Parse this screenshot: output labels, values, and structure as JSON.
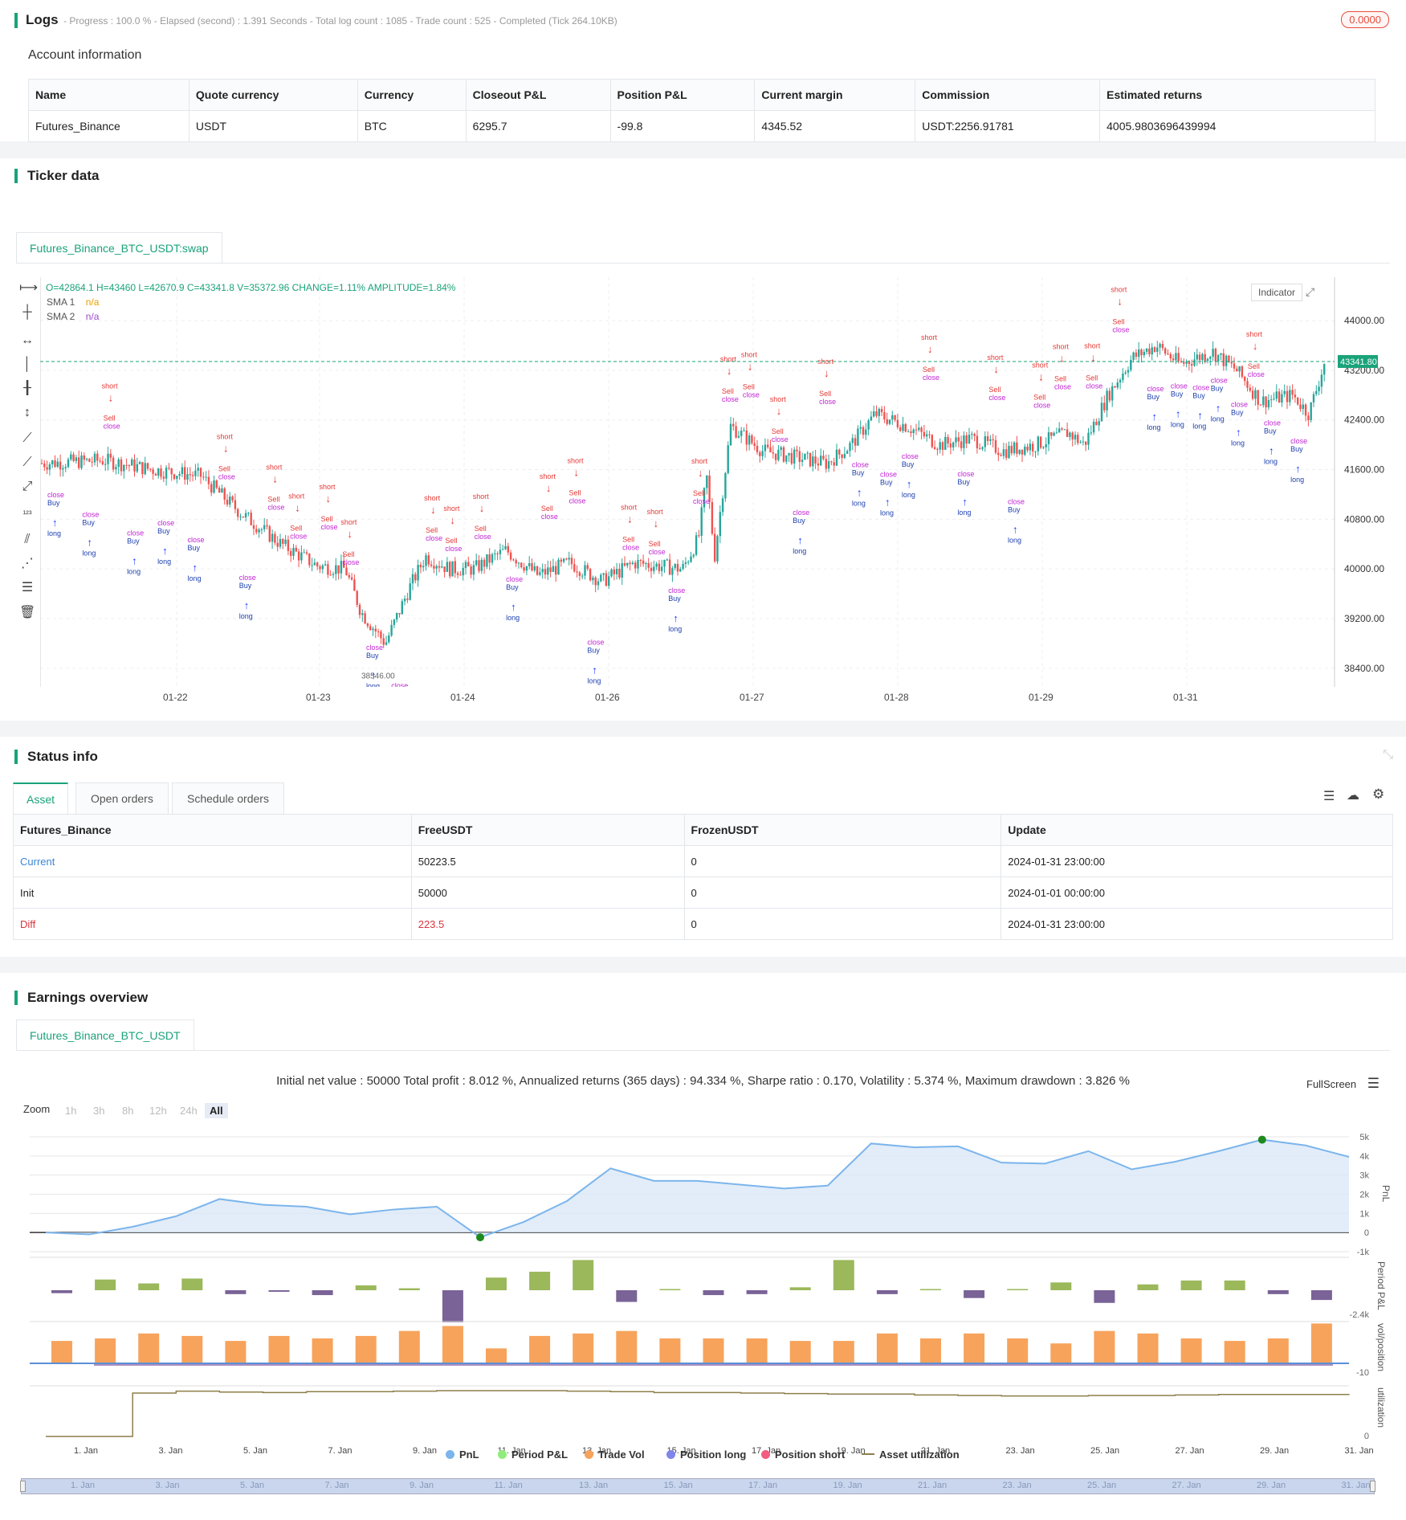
{
  "logs": {
    "title": "Logs",
    "progress_text": "- Progress : 100.0 % - Elapsed (second) : 1.391 Seconds - Total log count : 1085 - Trade count : 525 - Completed (Tick 264.10KB)",
    "badge": "0.0000"
  },
  "account": {
    "title": "Account information",
    "headers": [
      "Name",
      "Quote currency",
      "Currency",
      "Closeout P&L",
      "Position P&L",
      "Current margin",
      "Commission",
      "Estimated returns"
    ],
    "row": [
      "Futures_Binance",
      "USDT",
      "BTC",
      "6295.7",
      "-99.8",
      "4345.52",
      "USDT:2256.91781",
      "4005.9803696439994"
    ]
  },
  "ticker": {
    "title": "Ticker data",
    "tab": "Futures_Binance_BTC_USDT:swap",
    "ohlc": "O=42864.1 H=43460 L=42670.9 C=43341.8 V=35372.96 CHANGE=1.11% AMPLITUDE=1.84%",
    "sma1_label": "SMA 1",
    "sma1_value": "n/a",
    "sma2_label": "SMA 2",
    "sma2_value": "n/a",
    "indicator_btn": "Indicator",
    "last_price": "43341.80",
    "low_marker": "38546.00",
    "y_ticks": [
      "44000.00",
      "43200.00",
      "42400.00",
      "41600.00",
      "40800.00",
      "40000.00",
      "39200.00",
      "38400.00"
    ],
    "x_ticks": [
      "01-22",
      "01-23",
      "01-24",
      "01-26",
      "01-27",
      "01-28",
      "01-29",
      "01-31"
    ]
  },
  "status": {
    "title": "Status info",
    "tabs": [
      "Asset",
      "Open orders",
      "Schedule orders"
    ],
    "headers": [
      "Futures_Binance",
      "FreeUSDT",
      "FrozenUSDT",
      "Update"
    ],
    "rows": [
      [
        "Current",
        "50223.5",
        "0",
        "2024-01-31 23:00:00"
      ],
      [
        "Init",
        "50000",
        "0",
        "2024-01-01 00:00:00"
      ],
      [
        "Diff",
        "223.5",
        "0",
        "2024-01-31 23:00:00"
      ]
    ]
  },
  "earnings": {
    "title": "Earnings overview",
    "tab": "Futures_Binance_BTC_USDT",
    "summary": "Initial net value : 50000 Total profit : 8.012 %, Annualized returns (365 days) : 94.334 %, Sharpe ratio : 0.170, Volatility : 5.374 %, Maximum drawdown : 3.826 %",
    "fullscreen": "FullScreen",
    "zoom_label": "Zoom",
    "zoom_options": [
      "1h",
      "3h",
      "8h",
      "12h",
      "24h",
      "All"
    ],
    "pnl_ticks": [
      "5k",
      "4k",
      "3k",
      "2k",
      "1k",
      "0",
      "-1k"
    ],
    "pnl_axis": "PnL",
    "period_axis": "Period P&L",
    "period_min": "-2.4k",
    "vol_axis": "vol/position",
    "vol_min": "-10",
    "util_axis": "utilization",
    "util_zero": "0",
    "x_ticks": [
      "1. Jan",
      "3. Jan",
      "5. Jan",
      "7. Jan",
      "9. Jan",
      "11. Jan",
      "13. Jan",
      "15. Jan",
      "17. Jan",
      "19. Jan",
      "21. Jan",
      "23. Jan",
      "25. Jan",
      "27. Jan",
      "29. Jan",
      "31. Jan"
    ],
    "legend": [
      "PnL",
      "Period P&L",
      "Trade Vol",
      "Position long",
      "Position short",
      "Asset utilization"
    ],
    "legend_colors": [
      "#7cb5ec",
      "#90ed7d",
      "#f7a35c",
      "#8085e9",
      "#f15c80",
      "#8d7f4a"
    ]
  },
  "chart_data": [
    {
      "type": "line",
      "title": "",
      "ylabel": "PnL",
      "x": [
        "1. Jan",
        "2. Jan",
        "3. Jan",
        "4. Jan",
        "5. Jan",
        "6. Jan",
        "7. Jan",
        "8. Jan",
        "9. Jan",
        "10. Jan",
        "11. Jan",
        "12. Jan",
        "13. Jan",
        "14. Jan",
        "15. Jan",
        "16. Jan",
        "17. Jan",
        "18. Jan",
        "19. Jan",
        "20. Jan",
        "21. Jan",
        "22. Jan",
        "23. Jan",
        "24. Jan",
        "25. Jan",
        "26. Jan",
        "27. Jan",
        "28. Jan",
        "29. Jan",
        "30. Jan",
        "31. Jan"
      ],
      "values": [
        0,
        -100,
        300,
        850,
        1750,
        1450,
        1350,
        950,
        1200,
        1350,
        -250,
        550,
        1650,
        3350,
        2700,
        2700,
        2500,
        2300,
        2450,
        4650,
        4450,
        4500,
        3650,
        3600,
        4250,
        3300,
        3700,
        4250,
        4850,
        4550,
        3950
      ],
      "ylim": [
        -1000,
        5000
      ]
    },
    {
      "type": "bar",
      "ylabel": "Period P&L",
      "values": [
        -150,
        550,
        350,
        600,
        -200,
        -80,
        -250,
        250,
        100,
        -1650,
        650,
        950,
        1550,
        -600,
        50,
        -250,
        -200,
        150,
        1550,
        -200,
        50,
        -400,
        0,
        400,
        -650,
        300,
        500,
        500,
        -200,
        -500
      ],
      "ylim": [
        -2400,
        2000
      ]
    },
    {
      "type": "bar",
      "ylabel": "vol/position",
      "values": [
        9,
        10,
        12,
        11,
        9,
        11,
        10,
        11,
        13,
        15,
        6,
        11,
        12,
        13,
        10,
        10,
        10,
        9,
        9,
        12,
        10,
        12,
        10,
        8,
        13,
        12,
        10,
        9,
        10,
        16
      ],
      "ylim": [
        -10,
        20
      ]
    },
    {
      "type": "line",
      "ylabel": "utilization",
      "values": [
        0,
        0,
        0.9,
        0.94,
        0.92,
        0.91,
        0.93,
        0.93,
        0.94,
        0.95,
        0.95,
        0.95,
        0.94,
        0.93,
        0.91,
        0.91,
        0.9,
        0.89,
        0.88,
        0.88,
        0.86,
        0.85,
        0.84,
        0.84,
        0.85,
        0.85,
        0.86,
        0.87,
        0.87,
        0.87,
        0.88
      ]
    }
  ]
}
